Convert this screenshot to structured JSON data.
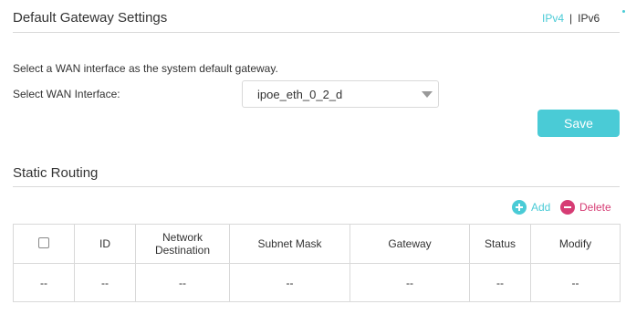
{
  "default_gateway": {
    "title": "Default Gateway Settings",
    "ipv4_label": "IPv4",
    "separator": "|",
    "ipv6_label": "IPv6",
    "description": "Select a WAN interface as the system default gateway.",
    "wan_label": "Select WAN Interface:",
    "wan_value": "ipoe_eth_0_2_d",
    "save_label": "Save"
  },
  "static_routing": {
    "title": "Static Routing",
    "add_label": "Add",
    "delete_label": "Delete",
    "columns": {
      "id": "ID",
      "network_destination_line1": "Network",
      "network_destination_line2": "Destination",
      "subnet_mask": "Subnet Mask",
      "gateway": "Gateway",
      "status": "Status",
      "modify": "Modify"
    },
    "rows": [
      {
        "checkbox": "--",
        "id": "--",
        "network_destination": "--",
        "subnet_mask": "--",
        "gateway": "--",
        "status": "--",
        "modify": "--"
      }
    ]
  },
  "colors": {
    "accent": "#4acbd6",
    "delete": "#d63c74",
    "border": "#d9d9d9",
    "text": "#333333"
  },
  "icons": {
    "add": "plus-circle-icon",
    "delete": "minus-circle-icon",
    "dropdown": "triangle-down-icon"
  }
}
